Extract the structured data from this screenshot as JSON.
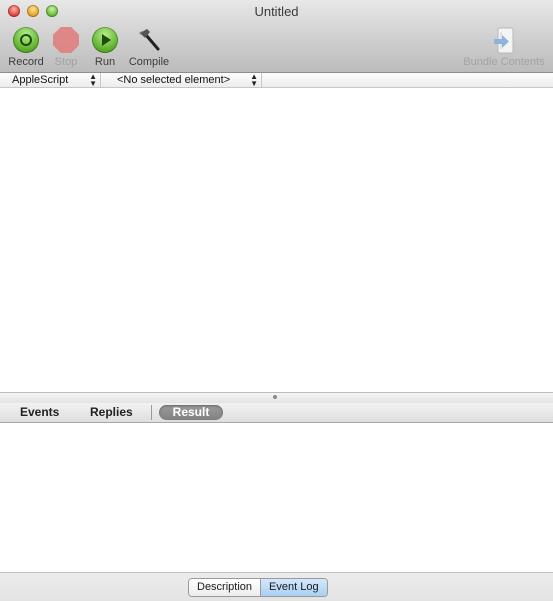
{
  "window": {
    "title": "Untitled"
  },
  "toolbar": {
    "items": [
      {
        "label": "Record",
        "icon": "record-icon",
        "enabled": true
      },
      {
        "label": "Stop",
        "icon": "stop-icon",
        "enabled": false
      },
      {
        "label": "Run",
        "icon": "run-icon",
        "enabled": true
      },
      {
        "label": "Compile",
        "icon": "hammer-icon",
        "enabled": true
      }
    ],
    "bundle_contents": {
      "label": "Bundle Contents",
      "icon": "bundle-contents-icon",
      "enabled": false
    }
  },
  "navigation_bar": {
    "language_popup": {
      "value": "AppleScript"
    },
    "element_popup": {
      "value": "<No selected element>"
    }
  },
  "editor": {
    "content": ""
  },
  "log_tabs": {
    "items": [
      {
        "label": "Events",
        "selected": false
      },
      {
        "label": "Replies",
        "selected": false
      },
      {
        "label": "Result",
        "selected": true
      }
    ]
  },
  "log_area": {
    "content": ""
  },
  "bottom_bar": {
    "segments": [
      {
        "label": "Description",
        "selected": false
      },
      {
        "label": "Event Log",
        "selected": true
      }
    ]
  },
  "colors": {
    "selected_segment": "#a9cff3",
    "selected_log_tab": "#8a8a8a",
    "record_run_green": "#5fb12d",
    "stop_red": "#e07a7a"
  }
}
